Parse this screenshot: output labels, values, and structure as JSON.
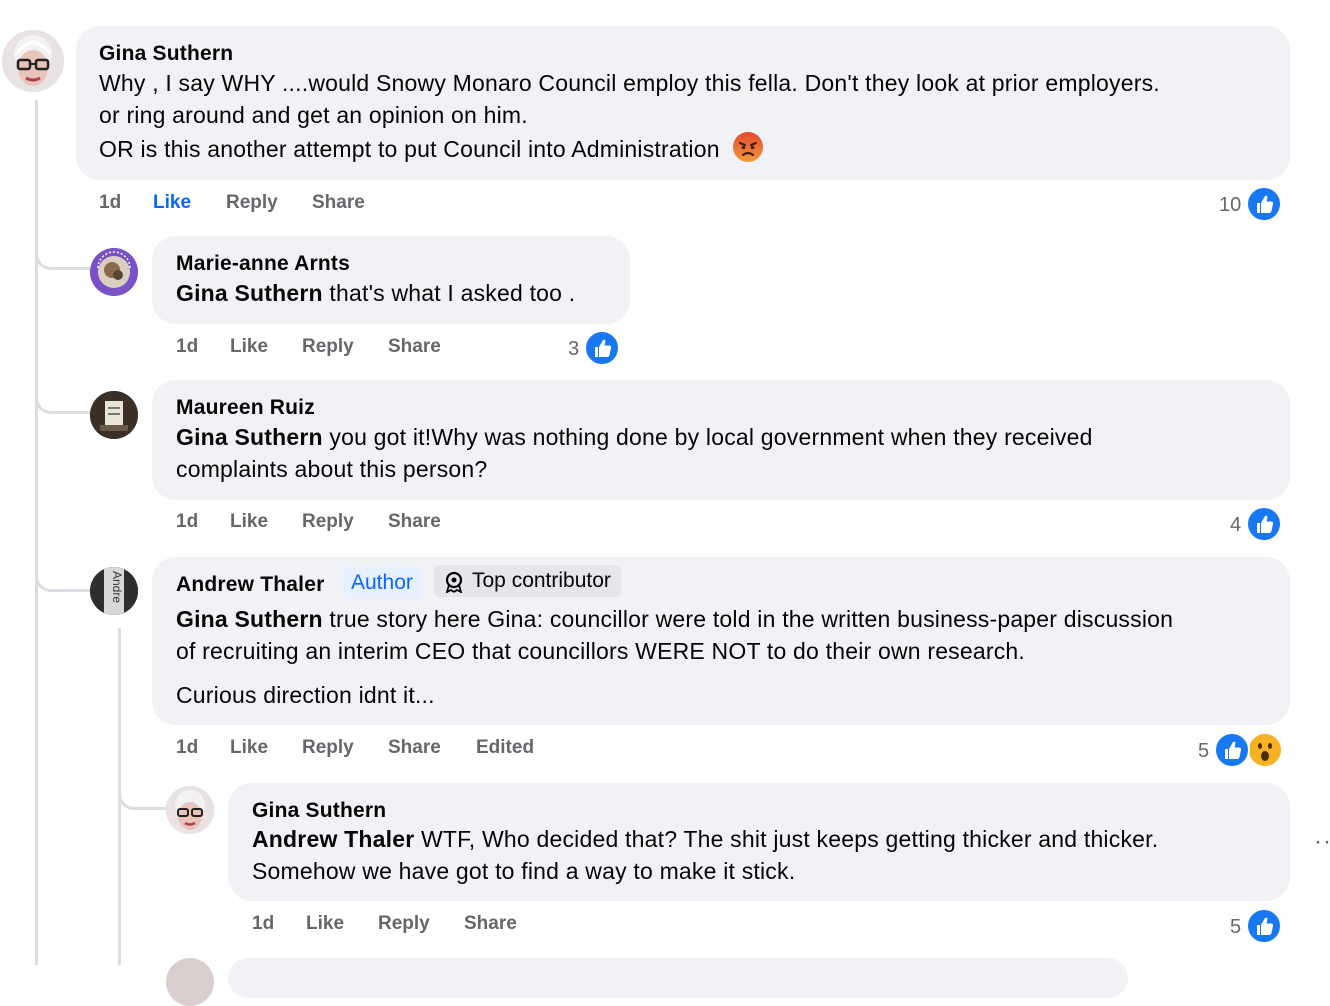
{
  "comments": [
    {
      "author": "Gina Suthern",
      "lines": [
        "Why , I say WHY ....would Snowy Monaro Council employ this fella. Don't they look at prior employers.",
        "or ring around and get an opinion on him.",
        "OR is this another attempt to put Council into Administration"
      ],
      "emoji": "angry-face",
      "time": "1d",
      "like": "Like",
      "reply": "Reply",
      "share": "Share",
      "reaction_count": "10"
    },
    {
      "author": "Marie-anne Arnts",
      "mention": "Gina Suthern",
      "text": " that's what I asked too .",
      "time": "1d",
      "like": "Like",
      "reply": "Reply",
      "share": "Share",
      "reaction_count": "3"
    },
    {
      "author": "Maureen Ruiz",
      "mention": "Gina Suthern",
      "text_line1": " you got it!Why was nothing done by local government when they received",
      "text_line2": "complaints about this person?",
      "time": "1d",
      "like": "Like",
      "reply": "Reply",
      "share": "Share",
      "reaction_count": "4"
    },
    {
      "author": "Andrew Thaler",
      "author_badge": "Author",
      "contributor_badge": "Top contributor",
      "avatar_text": "Andre",
      "mention": "Gina Suthern",
      "text_line1": " true story here Gina: councillor were told in the written business-paper discussion",
      "text_line2": "of recruiting an interim CEO that councillors WERE NOT to do their own research.",
      "text_line3": "Curious direction idnt it...",
      "time": "1d",
      "like": "Like",
      "reply": "Reply",
      "share": "Share",
      "edited": "Edited",
      "reaction_count": "5"
    },
    {
      "author": "Gina Suthern",
      "mention": "Andrew Thaler",
      "text_line1": " WTF, Who decided that? The shit just keeps getting thicker and thicker.",
      "text_line2": "Somehow we have got to find a way to make it stick.",
      "time": "1d",
      "like": "Like",
      "reply": "Reply",
      "share": "Share",
      "reaction_count": "5",
      "more": "··"
    }
  ],
  "colors": {
    "bubble": "#f0f2f5",
    "like_blue": "#1877f2",
    "link_blue": "#0866ff",
    "meta_gray": "#65676b"
  }
}
